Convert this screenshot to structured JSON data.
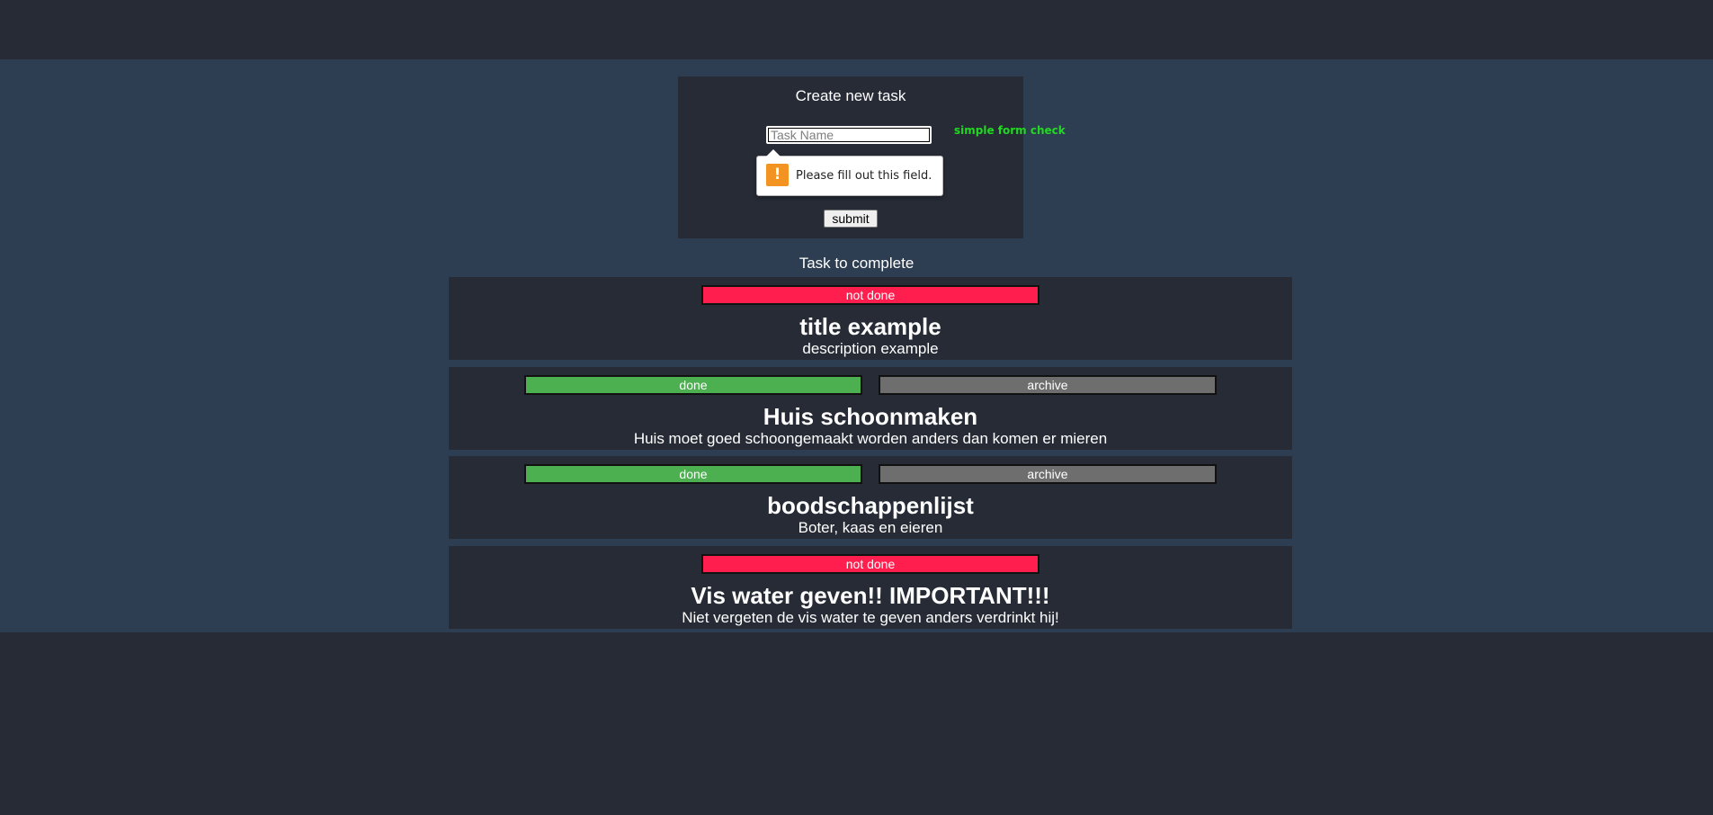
{
  "form": {
    "title": "Create new task",
    "input_placeholder": "Task Name",
    "input_value": "",
    "hint": "simple form check",
    "validation_message": "Please fill out this field.",
    "submit_label": "submit"
  },
  "list": {
    "title": "Task to complete"
  },
  "tasks": [
    {
      "status_label": "not done",
      "title": "title example",
      "description": "description example"
    },
    {
      "status_label": "done",
      "archive_label": "archive",
      "title": "Huis schoonmaken",
      "description": "Huis moet goed schoongemaakt worden anders dan komen er mieren"
    },
    {
      "status_label": "done",
      "archive_label": "archive",
      "title": "boodschappenlijst",
      "description": "Boter, kaas en eieren"
    },
    {
      "status_label": "not done",
      "title": "Vis water geven!! IMPORTANT!!!",
      "description": "Niet vergeten de vis water te geven anders verdrinkt hij!"
    }
  ],
  "colors": {
    "not_done": "#ff1e4e",
    "done": "#4caf50",
    "archive": "#6e6e6e",
    "hint": "#23d823",
    "warning": "#f39321"
  },
  "icons": {
    "validation": "warning-icon"
  }
}
